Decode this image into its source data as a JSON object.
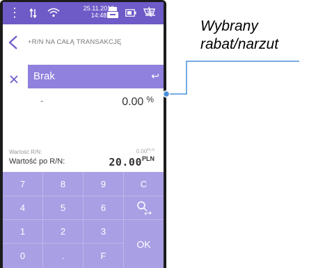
{
  "status_bar": {
    "date": "25.11.2018",
    "time": "14:48"
  },
  "header": {
    "title": "+R/N NA CAŁĄ TRANSAKCJĘ"
  },
  "selection": {
    "value": "Brak",
    "swap_glyph": "↩"
  },
  "input": {
    "dash": "-",
    "value": "0.00",
    "unit": "%"
  },
  "summary": {
    "discount_label": "Wartość R/N:",
    "discount_value": "0.00",
    "discount_unit": "PLN",
    "after_label": "Wartość po R/N:",
    "after_value": "20.00",
    "after_unit": "PLN"
  },
  "keypad": {
    "row1": [
      "7",
      "8",
      "9",
      "C"
    ],
    "row2": [
      "4",
      "5",
      "6"
    ],
    "row3": [
      "1",
      "2",
      "3"
    ],
    "row4": [
      "0",
      ".",
      "F"
    ],
    "ok": "OK"
  },
  "callout": {
    "line1": "Wybrany",
    "line2": "rabat/narzut"
  },
  "colors": {
    "status_bar": "#6f5bc7",
    "selection": "#8f81dd",
    "keypad": "#a99fe4",
    "leader": "#4a90d9"
  }
}
